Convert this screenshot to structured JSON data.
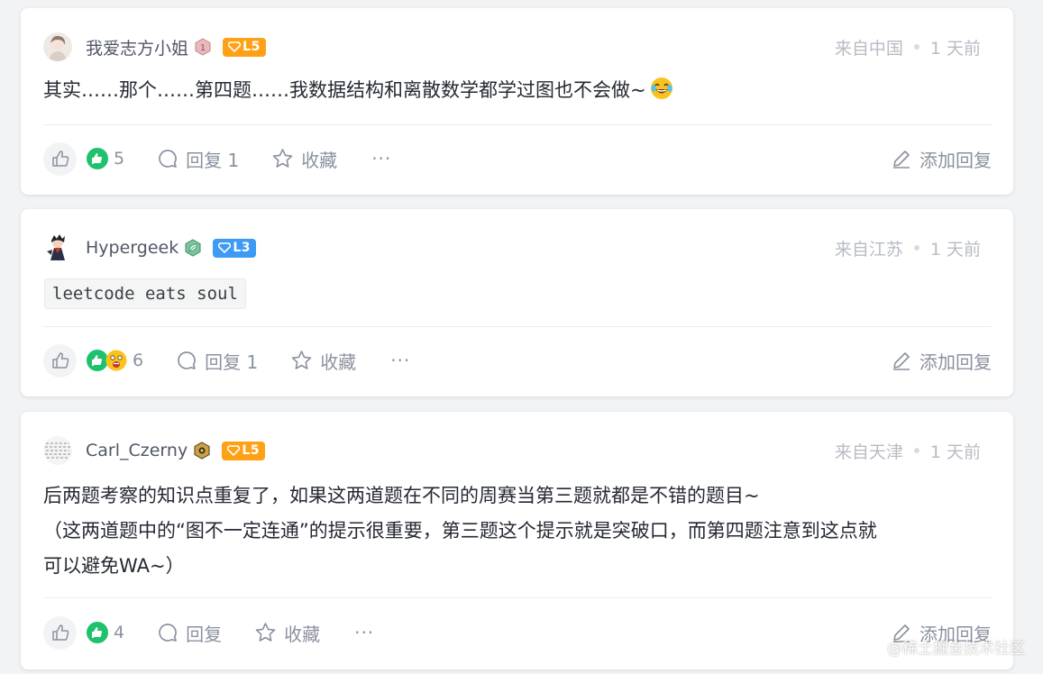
{
  "comments": [
    {
      "username": "我爱志方小姐",
      "level": "L5",
      "level_color": "#ffa116",
      "location": "来自中国",
      "time": "1 天前",
      "content": "其实……那个……第四题……我数据结构和离散数学都学过图也不会做~",
      "emoji": "joy-emoji",
      "like_count": "5",
      "reply_label": "回复 1",
      "fav_label": "收藏",
      "more": "···",
      "add_reply": "添加回复"
    },
    {
      "username": "Hypergeek",
      "level": "L3",
      "level_color": "#3d9bf5",
      "location": "来自江苏",
      "time": "1 天前",
      "code": "leetcode eats soul",
      "like_count": "6",
      "reply_label": "回复 1",
      "fav_label": "收藏",
      "more": "···",
      "add_reply": "添加回复"
    },
    {
      "username": "Carl_Czerny",
      "level": "L5",
      "level_color": "#ffa116",
      "location": "来自天津",
      "time": "1 天前",
      "content_lines": [
        "后两题考察的知识点重复了，如果这两道题在不同的周赛当第三题就都是不错的题目~",
        "（这两道题中的“图不一定连通”的提示很重要，第三题这个提示就是突破口，而第四题注意到这点就",
        "可以避免WA~）"
      ],
      "like_count": "4",
      "reply_label": "回复",
      "fav_label": "收藏",
      "more": "···",
      "add_reply": "添加回复"
    }
  ],
  "watermark": "@稀土掘金技术社区"
}
